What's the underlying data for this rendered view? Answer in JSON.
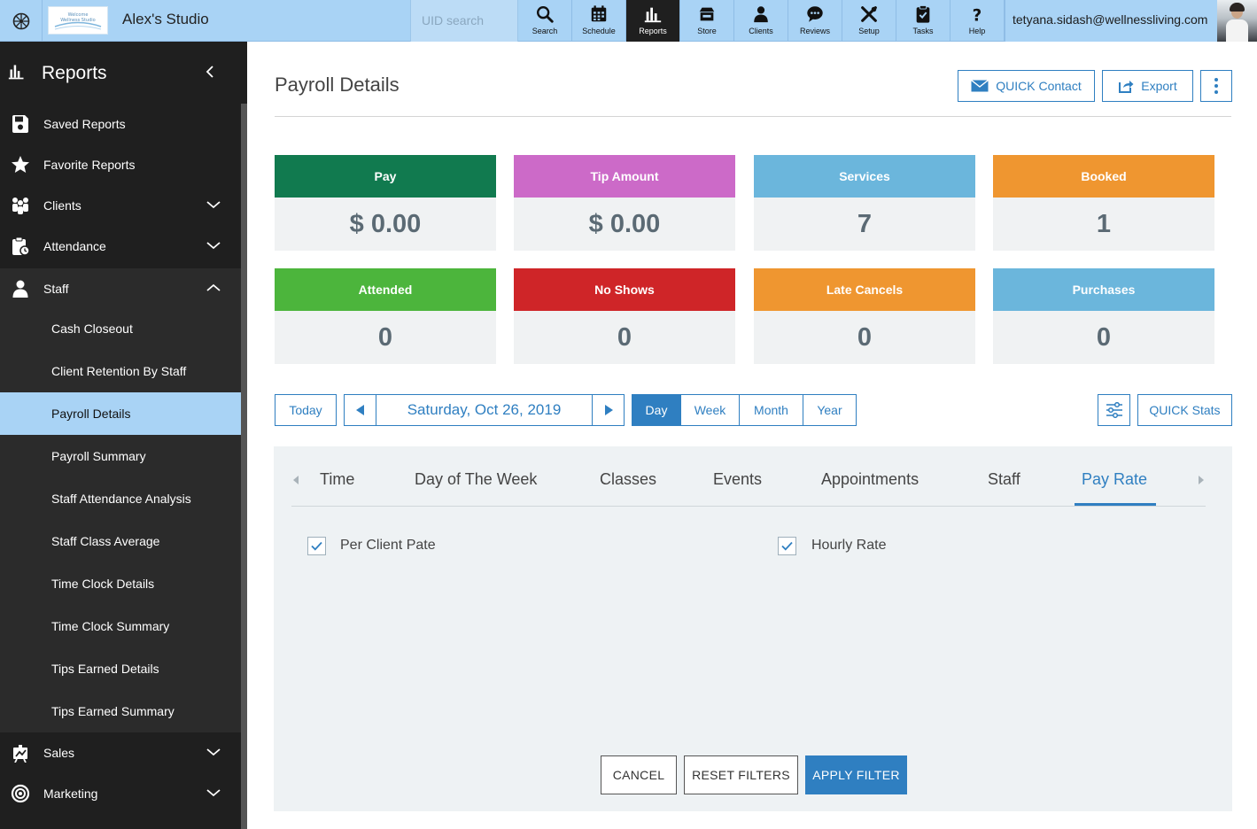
{
  "topbar": {
    "brand_text": "Welcome Wellness Studio",
    "studio_name": "Alex's Studio",
    "uid_placeholder": "UID search",
    "nav": [
      {
        "label": "Search",
        "icon": "search-icon"
      },
      {
        "label": "Schedule",
        "icon": "calendar-icon"
      },
      {
        "label": "Reports",
        "icon": "bar-chart-icon",
        "active": true
      },
      {
        "label": "Store",
        "icon": "store-icon"
      },
      {
        "label": "Clients",
        "icon": "person-icon"
      },
      {
        "label": "Reviews",
        "icon": "chat-bubble-icon"
      },
      {
        "label": "Setup",
        "icon": "tools-icon"
      },
      {
        "label": "Tasks",
        "icon": "clipboard-icon"
      },
      {
        "label": "Help",
        "icon": "question-icon"
      }
    ],
    "user_email": "tetyana.sidash@wellnessliving.com"
  },
  "sidebar": {
    "title": "Reports",
    "items": [
      {
        "label": "Saved Reports",
        "icon": "save-icon"
      },
      {
        "label": "Favorite Reports",
        "icon": "star-icon"
      },
      {
        "label": "Clients",
        "icon": "clients-icon",
        "expandable": true
      },
      {
        "label": "Attendance",
        "icon": "attendance-icon",
        "expandable": true
      },
      {
        "label": "Staff",
        "icon": "person-icon",
        "expanded": true
      }
    ],
    "staff_subitems": [
      {
        "label": "Cash Closeout"
      },
      {
        "label": "Client Retention By Staff"
      },
      {
        "label": "Payroll Details",
        "active": true
      },
      {
        "label": "Payroll Summary"
      },
      {
        "label": "Staff Attendance Analysis"
      },
      {
        "label": "Staff Class Average"
      },
      {
        "label": "Time Clock Details"
      },
      {
        "label": "Time Clock Summary"
      },
      {
        "label": "Tips Earned Details"
      },
      {
        "label": "Tips Earned Summary"
      }
    ],
    "bottom_items": [
      {
        "label": "Sales",
        "icon": "sales-icon"
      },
      {
        "label": "Marketing",
        "icon": "target-icon"
      }
    ]
  },
  "main": {
    "page_title": "Payroll Details",
    "quick_contact_label": "QUICK Contact",
    "export_label": "Export",
    "cards": [
      {
        "title": "Pay",
        "value": "$ 0.00",
        "color": "#117a4f"
      },
      {
        "title": "Tip Amount",
        "value": "$ 0.00",
        "color": "#cc6ac8"
      },
      {
        "title": "Services",
        "value": "7",
        "color": "#6bb6dc"
      },
      {
        "title": "Booked",
        "value": "1",
        "color": "#ef9630"
      },
      {
        "title": "Attended",
        "value": "0",
        "color": "#4cb53c"
      },
      {
        "title": "No Shows",
        "value": "0",
        "color": "#cf2528"
      },
      {
        "title": "Late Cancels",
        "value": "0",
        "color": "#ef9630"
      },
      {
        "title": "Purchases",
        "value": "0",
        "color": "#6bb6dc"
      }
    ],
    "date_nav": {
      "today_label": "Today",
      "date": "Saturday, Oct 26, 2019",
      "periods": [
        "Day",
        "Week",
        "Month",
        "Year"
      ],
      "active_period": "Day",
      "quick_stats_label": "QUICK Stats"
    },
    "filter": {
      "tabs": [
        "Time",
        "Day of The Week",
        "Classes",
        "Events",
        "Appointments",
        "Staff",
        "Pay Rate"
      ],
      "active_tab": "Pay Rate",
      "options": [
        {
          "label": "Per Client Pate",
          "checked": true
        },
        {
          "label": "Hourly Rate",
          "checked": true
        }
      ],
      "cancel_label": "CANCEL",
      "reset_label": "RESET FILTERS",
      "apply_label": "APPLY FILTER"
    }
  },
  "colors": {
    "accent": "#2f7fc1",
    "topbar": "#a9d3f5",
    "sidebar": "#1f1f1f"
  }
}
